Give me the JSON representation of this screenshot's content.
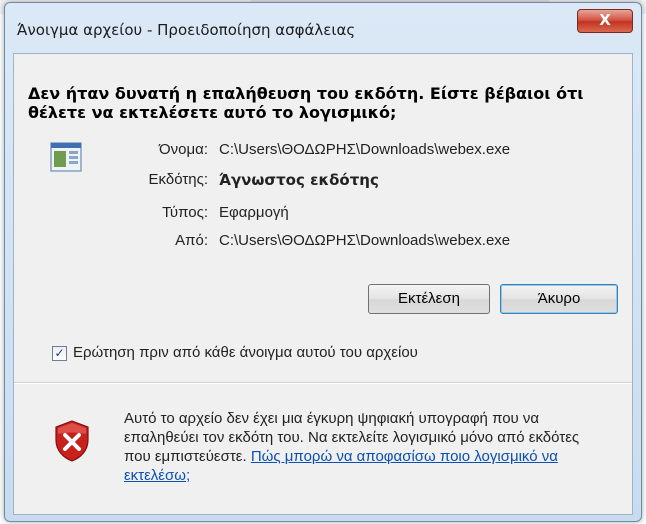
{
  "window": {
    "title": "Άνοιγμα αρχείου - Προειδοποίηση ασφάλειας",
    "close_label": "X"
  },
  "dialog": {
    "headline": "Δεν ήταν δυνατή η επαλήθευση του εκδότη. Είστε βέβαιοι ότι θέλετε να εκτελέσετε αυτό το λογισμικό;",
    "details": {
      "name_label": "Όνομα:",
      "name_value": "C:\\Users\\ΘΟΔΩΡΗΣ\\Downloads\\webex.exe",
      "publisher_label": "Εκδότης:",
      "publisher_value": "Άγνωστος εκδότης",
      "type_label": "Τύπος:",
      "type_value": "Εφαρμογή",
      "from_label": "Από:",
      "from_value": "C:\\Users\\ΘΟΔΩΡΗΣ\\Downloads\\webex.exe"
    },
    "buttons": {
      "run_label": "Εκτέλεση",
      "cancel_label": "Άκυρο"
    },
    "checkbox": {
      "label": "Ερώτηση πριν από κάθε άνοιγμα αυτού του αρχείου",
      "checked": true,
      "mark": "✓"
    },
    "warning": {
      "text": "Αυτό το αρχείο δεν έχει μια έγκυρη ψηφιακή υπογραφή που να επαληθεύει τον εκδότη του. Να εκτελείτε λογισμικό μόνο από εκδότες που εμπιστεύεστε.",
      "link": "Πώς μπορώ να αποφασίσω ποιο λογισμικό να εκτελέσω;"
    },
    "icons": {
      "file": "application-file-icon",
      "warning": "red-shield-x-icon"
    },
    "colors": {
      "link": "#0a4fb3",
      "shield": "#c8201c",
      "close_button": "#c2311f"
    }
  }
}
